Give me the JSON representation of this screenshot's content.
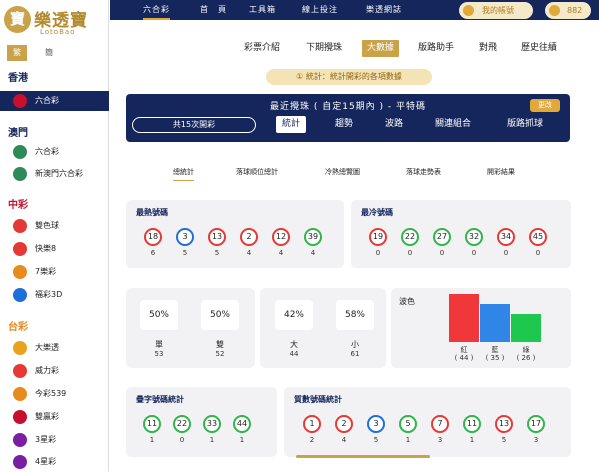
{
  "brand": {
    "name": "樂透寶",
    "sub": "LotoBao"
  },
  "lang": {
    "trad": "繁",
    "simp": "簡"
  },
  "sidebar": {
    "regions": [
      "香港",
      "澳門",
      "中彩",
      "台彩"
    ],
    "items": [
      {
        "label": "六合彩",
        "icon": "hk-flag-icon",
        "color": "#c8102e"
      },
      {
        "label": "六合彩",
        "icon": "macau-lottery-icon",
        "color": "#2e8b57"
      },
      {
        "label": "新澳門六合彩",
        "icon": "macau-lottery-icon",
        "color": "#2e8b57"
      },
      {
        "label": "雙色球",
        "icon": "ssq-icon",
        "color": "#e53935"
      },
      {
        "label": "快樂8",
        "icon": "kl8-icon",
        "color": "#e53935"
      },
      {
        "label": "7樂彩",
        "icon": "qlc-icon",
        "color": "#e98a1c"
      },
      {
        "label": "福彩3D",
        "icon": "fc3d-icon",
        "color": "#1e6fd9"
      },
      {
        "label": "大樂透",
        "icon": "dlt-icon",
        "color": "#e9a21c"
      },
      {
        "label": "威力彩",
        "icon": "wlc-icon",
        "color": "#e53935"
      },
      {
        "label": "今彩539",
        "icon": "jc539-icon",
        "color": "#e98a1c"
      },
      {
        "label": "雙贏彩",
        "icon": "syc-icon",
        "color": "#c8102e"
      },
      {
        "label": "3星彩",
        "icon": "3xc-icon",
        "color": "#7b1fa2"
      },
      {
        "label": "4星彩",
        "icon": "4xc-icon",
        "color": "#7b1fa2"
      }
    ]
  },
  "topnav": [
    "六合彩",
    "首　頁",
    "工具箱",
    "線上投注",
    "樂透網誌"
  ],
  "account": {
    "label": "我的帳號",
    "coins": "882"
  },
  "subnav": [
    "彩票介紹",
    "下期攪珠",
    "大數據",
    "版路助手",
    "對飛",
    "歷史往績"
  ],
  "note": "① 統計：統計開彩的各項數據",
  "panel": {
    "title": "最近攪珠 ( 自定15期內 ) - 平特碼",
    "change": "更改",
    "count": "共15次開彩",
    "tabs": [
      "統計",
      "趨勢",
      "波路",
      "關連組合",
      "版路抓球"
    ]
  },
  "stat_tabs": [
    "總統計",
    "落球順位總計",
    "冷熱總覽圖",
    "落球走勢表",
    "開彩結果"
  ],
  "hot": {
    "title": "最熱號碼",
    "balls": [
      {
        "n": "18",
        "c": "r",
        "cnt": "6"
      },
      {
        "n": "3",
        "c": "b",
        "cnt": "5"
      },
      {
        "n": "13",
        "c": "r",
        "cnt": "5"
      },
      {
        "n": "2",
        "c": "r",
        "cnt": "4"
      },
      {
        "n": "12",
        "c": "r",
        "cnt": "4"
      },
      {
        "n": "39",
        "c": "g",
        "cnt": "4"
      }
    ]
  },
  "cold": {
    "title": "最冷號碼",
    "balls": [
      {
        "n": "19",
        "c": "r",
        "cnt": "0"
      },
      {
        "n": "22",
        "c": "g",
        "cnt": "0"
      },
      {
        "n": "27",
        "c": "g",
        "cnt": "0"
      },
      {
        "n": "32",
        "c": "g",
        "cnt": "0"
      },
      {
        "n": "34",
        "c": "r",
        "cnt": "0"
      },
      {
        "n": "45",
        "c": "r",
        "cnt": "0"
      }
    ]
  },
  "odd_even": [
    {
      "pct": "50%",
      "label": "單",
      "count": "53"
    },
    {
      "pct": "50%",
      "label": "雙",
      "count": "52"
    }
  ],
  "big_small": [
    {
      "pct": "42%",
      "label": "大",
      "count": "44"
    },
    {
      "pct": "58%",
      "label": "小",
      "count": "61"
    }
  ],
  "wave": {
    "title": "波色",
    "bars": [
      {
        "label": "紅",
        "count": "( 44 )",
        "value": 44,
        "color": "#f0383b"
      },
      {
        "label": "藍",
        "count": "( 35 )",
        "value": 35,
        "color": "#2f86e6"
      },
      {
        "label": "綠",
        "count": "( 26 )",
        "value": 26,
        "color": "#1ec84e"
      }
    ]
  },
  "repeat": {
    "title": "疊字號碼統計",
    "balls": [
      {
        "n": "11",
        "c": "g",
        "cnt": "1"
      },
      {
        "n": "22",
        "c": "g",
        "cnt": "0"
      },
      {
        "n": "33",
        "c": "g",
        "cnt": "1"
      },
      {
        "n": "44",
        "c": "g",
        "cnt": "1"
      }
    ]
  },
  "prime": {
    "title": "質數號碼統計",
    "balls": [
      {
        "n": "1",
        "c": "r",
        "cnt": "2"
      },
      {
        "n": "2",
        "c": "r",
        "cnt": "4"
      },
      {
        "n": "3",
        "c": "b",
        "cnt": "5"
      },
      {
        "n": "5",
        "c": "g",
        "cnt": "1"
      },
      {
        "n": "7",
        "c": "r",
        "cnt": "3"
      },
      {
        "n": "11",
        "c": "g",
        "cnt": "1"
      },
      {
        "n": "13",
        "c": "r",
        "cnt": "5"
      },
      {
        "n": "17",
        "c": "g",
        "cnt": "3"
      }
    ]
  }
}
